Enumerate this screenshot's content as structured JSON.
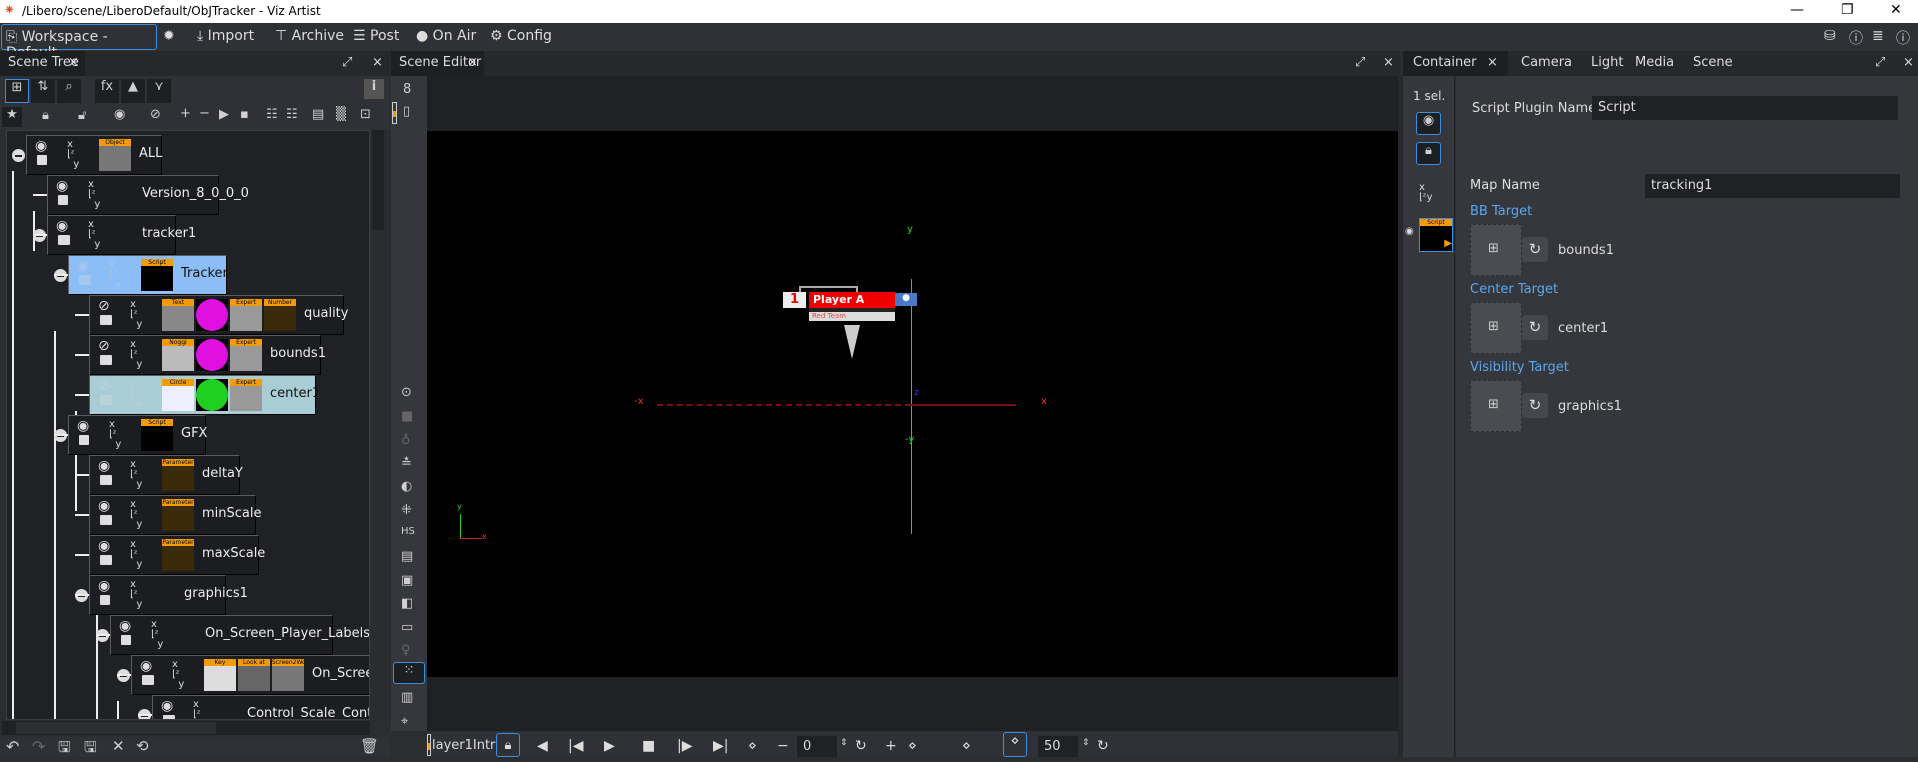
{
  "window": {
    "title": "/Libero/scene/LiberoDefault/ObJTracker - Viz Artist",
    "minimize": "—",
    "restore": "❐",
    "close": "✕"
  },
  "menubar": {
    "workspace": "Workspace - Default",
    "import": "Import",
    "archive": "Archive",
    "post": "Post",
    "on_air": "On Air",
    "config": "Config"
  },
  "scene_tree": {
    "tab": "Scene Tree",
    "info": "i",
    "rows": [
      {
        "label": "ALL",
        "level": 0,
        "collapse": true,
        "eye": "visible",
        "lock": "unlocked",
        "thumbs": [
          {
            "h": "Object",
            "c": "#777"
          }
        ]
      },
      {
        "label": "Version_8_0_0_0",
        "level": 1,
        "collapse": false,
        "eye": "visible",
        "lock": "unlocked",
        "thumbs": []
      },
      {
        "label": "tracker1",
        "level": 1,
        "collapse": true,
        "eye": "visible",
        "lock": "locked",
        "thumbs": []
      },
      {
        "label": "Tracker",
        "level": 2,
        "collapse": true,
        "eye": "visible",
        "lock": "locked",
        "thumbs": [
          {
            "h": "Script",
            "c": "#000"
          }
        ],
        "highlight": "blue"
      },
      {
        "label": "quality",
        "level": 3,
        "collapse": false,
        "eye": "hidden",
        "lock": "locked",
        "thumbs": [
          {
            "h": "Text",
            "c": "#888"
          },
          {
            "h": "",
            "c": "#e010e0"
          },
          {
            "h": "Expert",
            "c": "#999"
          },
          {
            "h": "Number",
            "c": "#3a2a0a"
          }
        ]
      },
      {
        "label": "bounds1",
        "level": 3,
        "collapse": false,
        "eye": "hidden",
        "lock": "locked",
        "thumbs": [
          {
            "h": "Noggi",
            "c": "#bbb"
          },
          {
            "h": "",
            "c": "#e010e0"
          },
          {
            "h": "Expert",
            "c": "#999"
          }
        ]
      },
      {
        "label": "center1",
        "level": 3,
        "collapse": false,
        "eye": "hidden",
        "lock": "locked",
        "thumbs": [
          {
            "h": "Circle",
            "c": "#eef"
          },
          {
            "h": "",
            "c": "#20d020"
          },
          {
            "h": "Expert",
            "c": "#999"
          }
        ],
        "highlight": "teal"
      },
      {
        "label": "GFX",
        "level": 2,
        "collapse": true,
        "eye": "visible",
        "lock": "unlocked",
        "thumbs": [
          {
            "h": "Script",
            "c": "#000"
          }
        ]
      },
      {
        "label": "deltaY",
        "level": 3,
        "collapse": false,
        "eye": "visible",
        "lock": "locked",
        "thumbs": [
          {
            "h": "Parameter",
            "c": "#3a2a0a"
          }
        ]
      },
      {
        "label": "minScale",
        "level": 3,
        "collapse": false,
        "eye": "visible",
        "lock": "locked",
        "thumbs": [
          {
            "h": "Parameter",
            "c": "#3a2a0a"
          }
        ]
      },
      {
        "label": "maxScale",
        "level": 3,
        "collapse": false,
        "eye": "visible",
        "lock": "locked",
        "thumbs": [
          {
            "h": "Parameter",
            "c": "#3a2a0a"
          }
        ]
      },
      {
        "label": "graphics1",
        "level": 3,
        "collapse": true,
        "eye": "visible",
        "lock": "unlocked",
        "thumbs": []
      },
      {
        "label": "On_Screen_Player_Labels",
        "level": 4,
        "collapse": true,
        "eye": "visible",
        "lock": "unlocked",
        "thumbs": []
      },
      {
        "label": "On_Screer",
        "level": 5,
        "collapse": true,
        "eye": "visible",
        "lock": "locked",
        "thumbs": [
          {
            "h": "Key",
            "c": "#ddd"
          },
          {
            "h": "Look at",
            "c": "#666"
          },
          {
            "h": "Screen2World",
            "c": "#777"
          }
        ]
      },
      {
        "label": "Control_Scale_Container",
        "level": 6,
        "collapse": true,
        "eye": "visible",
        "lock": "locked",
        "thumbs": []
      }
    ]
  },
  "scene_editor": {
    "tab": "Scene Editor",
    "layer_count": "8",
    "overlay": {
      "player_number": "1",
      "player_name": "Player A",
      "team": "Red Team",
      "axis_y": "y",
      "axis_neg_y": "-y",
      "axis_x": "x",
      "axis_neg_x": "-x",
      "axis_z": "z"
    }
  },
  "timeline": {
    "director": "layer1Intr",
    "start_value": "0",
    "end_value": "50"
  },
  "right_panel": {
    "tabs": [
      "Container",
      "Camera",
      "Light",
      "Media",
      "Scene"
    ],
    "active_tab": "Container",
    "selection": "1 sel.",
    "script_plugin_label": "Script Plugin Name:",
    "script_plugin_value": "Script",
    "map_name_label": "Map Name",
    "map_name_value": "tracking1",
    "targets": [
      {
        "header": "BB Target",
        "value": "bounds1"
      },
      {
        "header": "Center Target",
        "value": "center1"
      },
      {
        "header": "Visibility Target",
        "value": "graphics1"
      }
    ],
    "thumb_label": "Script"
  },
  "colors": {
    "accent": "#3a8fe0",
    "selection_blue": "#8bbdf7",
    "selection_teal": "#a9cdd4",
    "plugin_orange": "#f59b00",
    "header_blue": "#5aa7f0"
  }
}
